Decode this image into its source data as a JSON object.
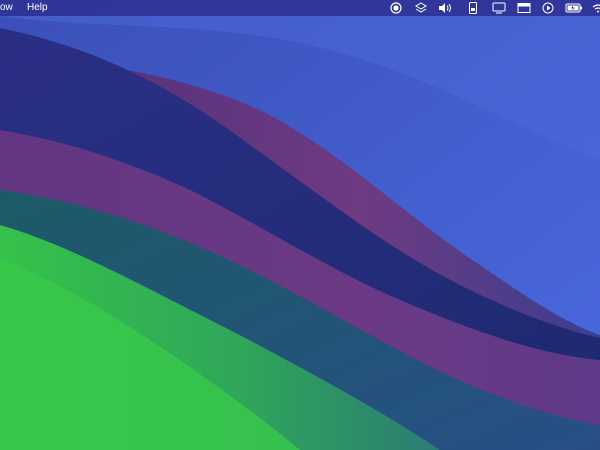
{
  "menubar": {
    "menus": [
      "ow",
      "Help"
    ]
  },
  "status_icons": [
    "record-icon",
    "layers-icon",
    "volume-icon",
    "display-icon",
    "screen-mirroring-icon",
    "window-icon",
    "play-icon",
    "battery-icon",
    "wifi-icon"
  ],
  "colors": {
    "menubar": "#3034a0",
    "wallpaper_blue": "#3a56c8",
    "wallpaper_navy": "#1f2a78",
    "wallpaper_purple": "#6a3a8a",
    "wallpaper_teal": "#1f5c6a",
    "wallpaper_green": "#35c24a"
  }
}
